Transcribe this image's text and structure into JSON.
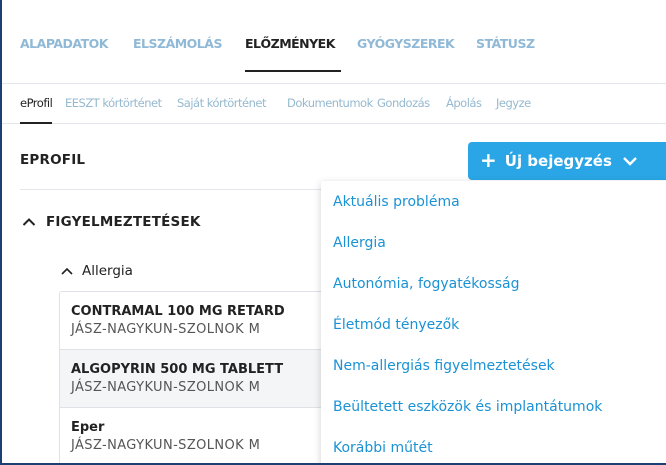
{
  "top_tabs": [
    {
      "label": "ALAPADATOK",
      "active": false
    },
    {
      "label": "ELSZÁMOLÁS",
      "active": false
    },
    {
      "label": "ELŐZMÉNYEK",
      "active": true
    },
    {
      "label": "GYÓGYSZEREK",
      "active": false
    },
    {
      "label": "STÁTUSZ",
      "active": false
    }
  ],
  "sub_tabs": [
    {
      "label": "eProfil",
      "active": true
    },
    {
      "label": "EESZT kórtörténet",
      "active": false
    },
    {
      "label": "Saját kórtörténet",
      "active": false
    },
    {
      "label": "Dokumentumok",
      "active": false
    },
    {
      "label": "Gondozás",
      "active": false
    },
    {
      "label": "Ápolás",
      "active": false
    },
    {
      "label": "Jegyze",
      "active": false
    }
  ],
  "section": {
    "title": "EPROFIL"
  },
  "new_button": {
    "label": "Új bejegyzés",
    "icon": "plus-icon",
    "dropdown_icon": "chevron-down-icon"
  },
  "group": {
    "title": "FIGYELMEZTETÉSEK",
    "subgroup": "Allergia"
  },
  "alerts": [
    {
      "name": "CONTRAMAL 100 MG RETARD",
      "place": "JÁSZ-NAGYKUN-SZOLNOK M"
    },
    {
      "name": "ALGOPYRIN 500 MG TABLETT",
      "place": "JÁSZ-NAGYKUN-SZOLNOK M"
    },
    {
      "name": "Eper",
      "place": "JÁSZ-NAGYKUN-SZOLNOK M"
    }
  ],
  "dropdown_items": [
    "Aktuális probléma",
    "Allergia",
    "Autonómia, fogyatékosság",
    "Életmód tényezők",
    "Nem-allergiás figyelmeztetések",
    "Beültetett eszközök és implantátumok",
    "Korábbi műtét"
  ],
  "colors": {
    "accent": "#2aa6e6",
    "link": "#1a92d4",
    "frame": "#1c3f73",
    "inactive_tab": "#8fb9d6"
  }
}
